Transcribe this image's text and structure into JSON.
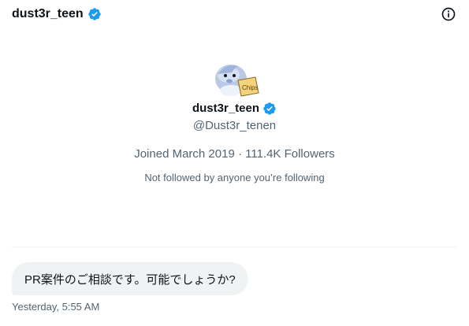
{
  "header": {
    "title": "dust3r_teen",
    "verified_icon": "verified-badge-icon",
    "info_icon": "info-icon"
  },
  "profile": {
    "avatar_icon": "dolphin-avatar",
    "avatar_badge_text": "Chips",
    "name": "dust3r_teen",
    "handle": "@Dust3r_tenen",
    "meta": "Joined March 2019 · 111.4K Followers",
    "followed_note": "Not followed by anyone you’re following"
  },
  "messages": [
    {
      "text": "PR案件のご相談です。可能でしょうか?",
      "timestamp": "Yesterday, 5:55 AM"
    }
  ],
  "colors": {
    "accent": "#1d9bf0",
    "text_primary": "#0f1419",
    "text_secondary": "#536471",
    "bubble_bg": "#eff3f4"
  }
}
